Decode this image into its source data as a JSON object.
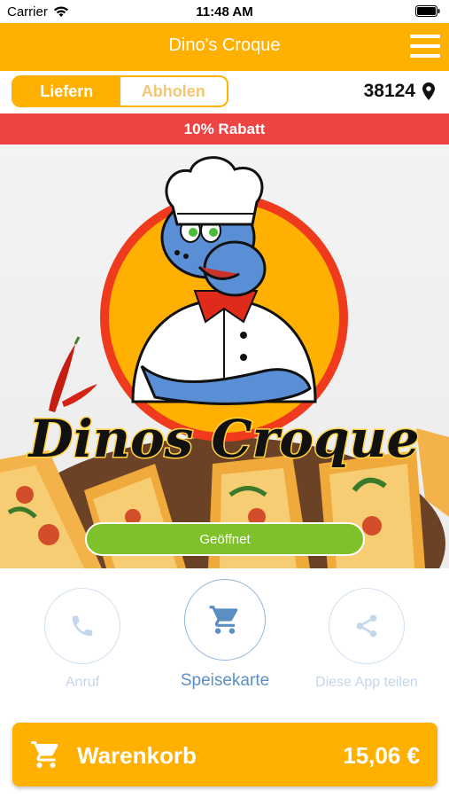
{
  "status_bar": {
    "carrier": "Carrier",
    "time": "11:48 AM"
  },
  "header": {
    "title": "Dino's Croque",
    "menu_icon": "hamburger-menu-icon"
  },
  "order_mode": {
    "options": [
      "Liefern",
      "Abholen"
    ],
    "selected": "Liefern"
  },
  "location": {
    "postcode": "38124",
    "icon": "location-pin-icon"
  },
  "discount_banner": {
    "text": "10% Rabatt"
  },
  "hero": {
    "logo_text": "Dinos Croque",
    "status_button": "Geöffnet"
  },
  "actions": [
    {
      "label": "Anruf",
      "icon": "phone-icon",
      "active": false
    },
    {
      "label": "Speisekarte",
      "icon": "cart-icon",
      "active": true
    },
    {
      "label": "Diese App teilen",
      "icon": "share-icon",
      "active": false
    }
  ],
  "cart": {
    "label": "Warenkorb",
    "total": "15,06 €",
    "icon": "cart-icon"
  },
  "colors": {
    "accent": "#ffb000",
    "discount": "#ee4444",
    "open": "#7ec12a",
    "link_blue": "#5b8fc4"
  }
}
